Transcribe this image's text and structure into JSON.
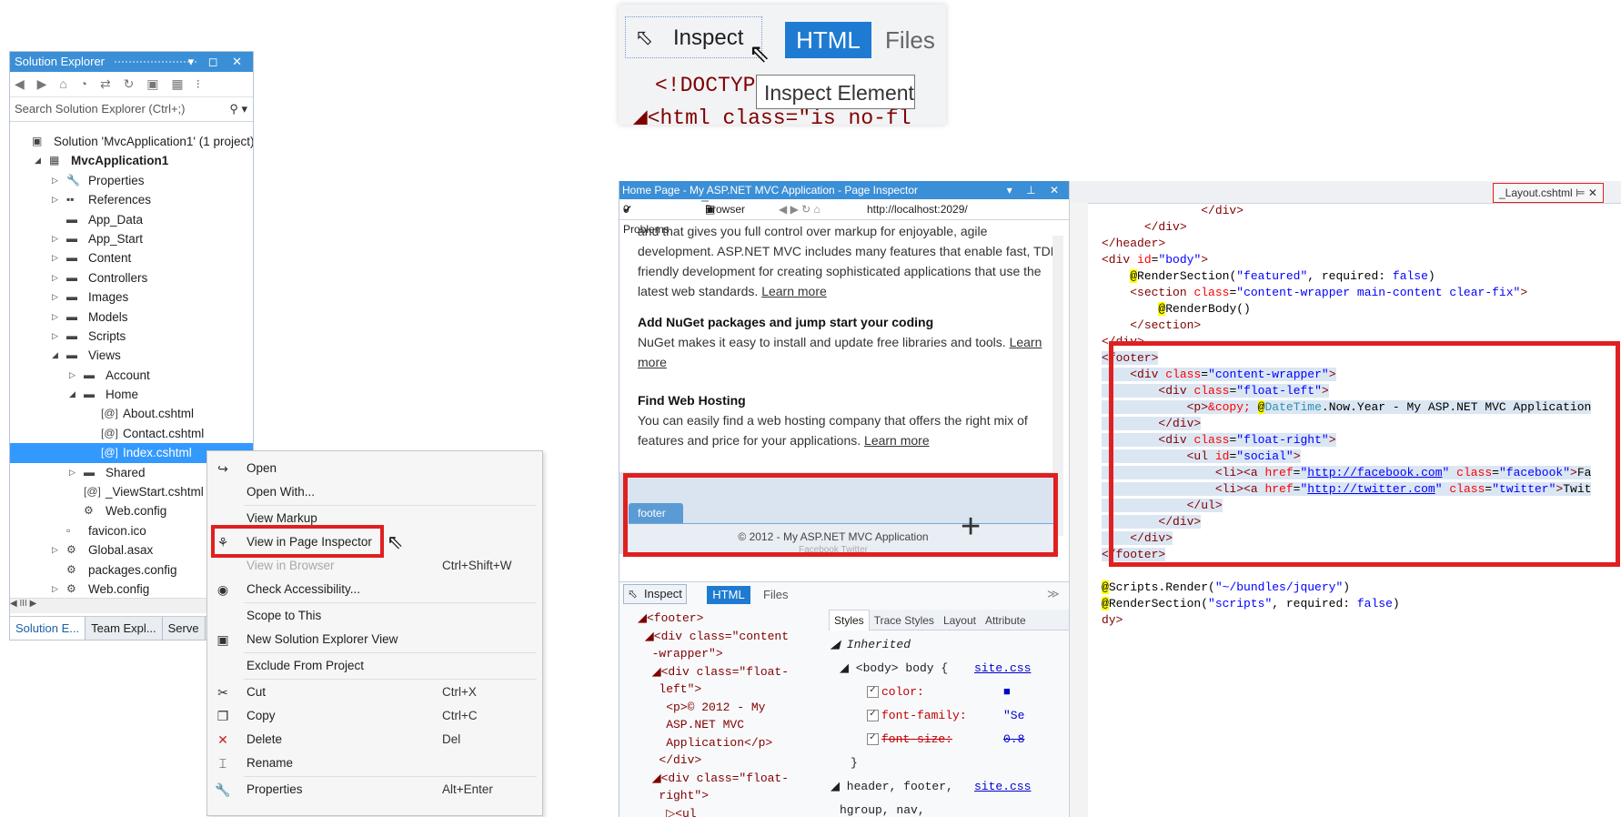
{
  "solution_explorer": {
    "title": "Solution Explorer",
    "title_controls": "▾ ◻ ✕",
    "toolbar_glyphs": "◀ ▶ ⌂ ◔ ⇄ ↻ ▣ ▦ ⁝",
    "search_placeholder": "Search Solution Explorer (Ctrl+;)",
    "tree": [
      {
        "label": "Solution 'MvcApplication1' (1 project)",
        "indent": 0,
        "arrow": "",
        "icon": "▣",
        "bold": false
      },
      {
        "label": "MvcApplication1",
        "indent": 1,
        "arrow": "◢",
        "icon": "▦",
        "bold": true
      },
      {
        "label": "Properties",
        "indent": 2,
        "arrow": "▷",
        "icon": "🔧",
        "bold": false
      },
      {
        "label": "References",
        "indent": 2,
        "arrow": "▷",
        "icon": "▪▪",
        "bold": false
      },
      {
        "label": "App_Data",
        "indent": 2,
        "arrow": "",
        "icon": "▬",
        "bold": false
      },
      {
        "label": "App_Start",
        "indent": 2,
        "arrow": "▷",
        "icon": "▬",
        "bold": false
      },
      {
        "label": "Content",
        "indent": 2,
        "arrow": "▷",
        "icon": "▬",
        "bold": false
      },
      {
        "label": "Controllers",
        "indent": 2,
        "arrow": "▷",
        "icon": "▬",
        "bold": false
      },
      {
        "label": "Images",
        "indent": 2,
        "arrow": "▷",
        "icon": "▬",
        "bold": false
      },
      {
        "label": "Models",
        "indent": 2,
        "arrow": "▷",
        "icon": "▬",
        "bold": false
      },
      {
        "label": "Scripts",
        "indent": 2,
        "arrow": "▷",
        "icon": "▬",
        "bold": false
      },
      {
        "label": "Views",
        "indent": 2,
        "arrow": "◢",
        "icon": "▬",
        "bold": false
      },
      {
        "label": "Account",
        "indent": 3,
        "arrow": "▷",
        "icon": "▬",
        "bold": false
      },
      {
        "label": "Home",
        "indent": 3,
        "arrow": "◢",
        "icon": "▬",
        "bold": false
      },
      {
        "label": "About.cshtml",
        "indent": 4,
        "arrow": "",
        "icon": "[@]",
        "bold": false
      },
      {
        "label": "Contact.cshtml",
        "indent": 4,
        "arrow": "",
        "icon": "[@]",
        "bold": false
      },
      {
        "label": "Index.cshtml",
        "indent": 4,
        "arrow": "",
        "icon": "[@]",
        "bold": false,
        "selected": true
      },
      {
        "label": "Shared",
        "indent": 3,
        "arrow": "▷",
        "icon": "▬",
        "bold": false
      },
      {
        "label": "_ViewStart.cshtml",
        "indent": 3,
        "arrow": "",
        "icon": "[@]",
        "bold": false
      },
      {
        "label": "Web.config",
        "indent": 3,
        "arrow": "",
        "icon": "⚙",
        "bold": false
      },
      {
        "label": "favicon.ico",
        "indent": 2,
        "arrow": "",
        "icon": "▫",
        "bold": false
      },
      {
        "label": "Global.asax",
        "indent": 2,
        "arrow": "▷",
        "icon": "⚙",
        "bold": false
      },
      {
        "label": "packages.config",
        "indent": 2,
        "arrow": "",
        "icon": "⚙",
        "bold": false
      },
      {
        "label": "Web.config",
        "indent": 2,
        "arrow": "▷",
        "icon": "⚙",
        "bold": false
      }
    ],
    "hscroll": "◀ III ▶",
    "tabs": [
      "Solution E...",
      "Team Expl...",
      "Serve"
    ]
  },
  "context_menu": {
    "items": [
      {
        "icon": "↪",
        "label": "Open",
        "shortcut": ""
      },
      {
        "icon": "",
        "label": "Open With...",
        "shortcut": "",
        "sep_after": true
      },
      {
        "icon": "",
        "label": "View Markup",
        "shortcut": ""
      },
      {
        "icon": "⚘",
        "label": "View in Page Inspector",
        "shortcut": ""
      },
      {
        "icon": "",
        "label": "View in Browser",
        "shortcut": "Ctrl+Shift+W",
        "disabled": true
      },
      {
        "icon": "◉",
        "label": "Check Accessibility...",
        "shortcut": "",
        "sep_after": true
      },
      {
        "icon": "",
        "label": "Scope to This",
        "shortcut": ""
      },
      {
        "icon": "▣",
        "label": "New Solution Explorer View",
        "shortcut": "",
        "sep_after": true
      },
      {
        "icon": "",
        "label": "Exclude From Project",
        "shortcut": "",
        "sep_after": true
      },
      {
        "icon": "✂",
        "label": "Cut",
        "shortcut": "Ctrl+X"
      },
      {
        "icon": "❐",
        "label": "Copy",
        "shortcut": "Ctrl+C"
      },
      {
        "icon": "✕",
        "label": "Delete",
        "shortcut": "Del"
      },
      {
        "icon": "⌶",
        "label": "Rename",
        "shortcut": "",
        "sep_after": true
      },
      {
        "icon": "🔧",
        "label": "Properties",
        "shortcut": "Alt+Enter"
      }
    ]
  },
  "inspect_popup": {
    "inspect_label": "Inspect",
    "html_tab": "HTML",
    "files_tab": "Files",
    "code_line1": "<!DOCTYP",
    "code_line2": "◢<html class=\"is no-fl",
    "tooltip": "Inspect Element"
  },
  "page_inspector": {
    "title": "Home Page - My ASP.NET MVC Application - Page Inspector",
    "title_controls": "▾ ⊥ ✕",
    "problems": "0 Problems",
    "browser_btn": "Browser",
    "url": "http://localhost:2029/",
    "para1": "and that gives you full control over markup for enjoyable, agile development. ASP.NET MVC includes many features that enable fast, TDD-friendly development for creating sophisticated applications that use the latest web standards.",
    "learn_more": "Learn more",
    "h2": "Add NuGet packages and jump start your coding",
    "para2": "NuGet makes it easy to install and update free libraries and tools.",
    "h3": "Find Web Hosting",
    "para3": "You can easily find a web hosting company that offers the right mix of features and price for your applications.",
    "footer_tag": "footer",
    "footer_text": "© 2012 - My ASP.NET MVC Application",
    "footer_sub": "Facebook  Twitter",
    "lower": {
      "inspect": "Inspect",
      "html": "HTML",
      "files": "Files",
      "tree": [
        "◢<footer>",
        " ◢<div class=\"content",
        "  -wrapper\">",
        "  ◢<div class=\"float-",
        "   left\">",
        "    <p>© 2012 - My",
        "    ASP.NET MVC",
        "    Application</p>",
        "   </div>",
        "  ◢<div class=\"float-",
        "   right\">",
        "    ▷<ul"
      ],
      "style_tabs": [
        "Styles",
        "Trace Styles",
        "Layout",
        "Attribute"
      ],
      "styles": [
        {
          "text": "◢ Inherited",
          "kind": "italic"
        },
        {
          "text": "◢ <body> body {",
          "link": "site.css",
          "kind": "rule"
        },
        {
          "text": "color:",
          "val": "■",
          "kind": "prop"
        },
        {
          "text": "font-family:",
          "val": "\"Se",
          "kind": "prop"
        },
        {
          "text": "font-size:",
          "val": "0.8",
          "kind": "strike"
        },
        {
          "text": "}",
          "kind": "close"
        },
        {
          "text": "◢ header, footer,",
          "link": "site.css",
          "kind": "rule"
        },
        {
          "text": "hgroup, nav,",
          "kind": "plain"
        },
        {
          "text": "section {",
          "kind": "plain"
        }
      ]
    }
  },
  "editor": {
    "tab": "_Layout.cshtml",
    "tab_icons": "⊨ ✕"
  },
  "colors": {
    "title_blue": "#3b8fd6",
    "selection": "#3399ff",
    "highlight_red": "#e02020",
    "html_tab_blue": "#1e7bd1"
  }
}
